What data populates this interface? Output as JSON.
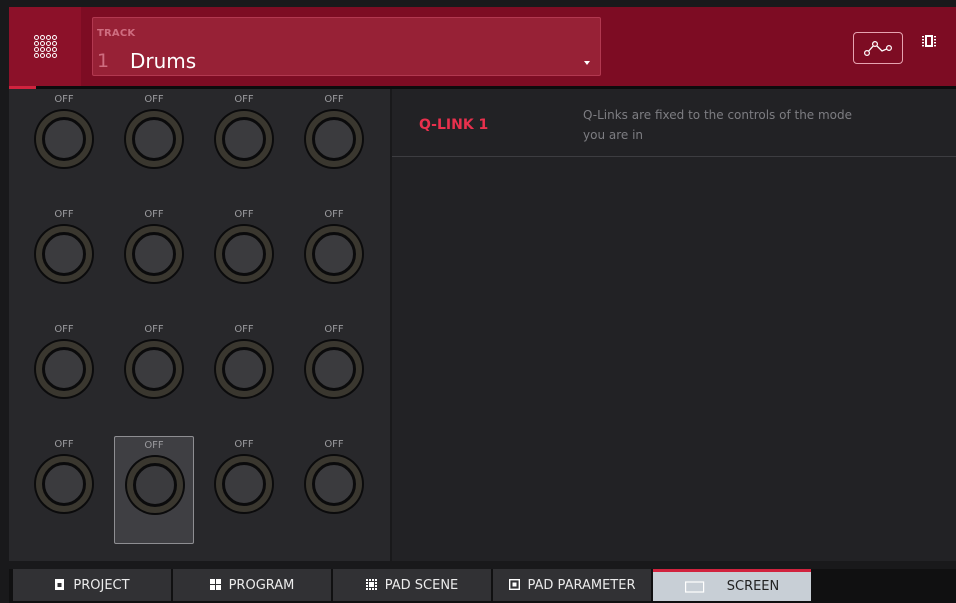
{
  "header": {
    "track_label": "TRACK",
    "track_number": "1",
    "track_name": "Drums"
  },
  "knobs": [
    {
      "value": "OFF"
    },
    {
      "value": "OFF"
    },
    {
      "value": "OFF"
    },
    {
      "value": "OFF"
    },
    {
      "value": "OFF"
    },
    {
      "value": "OFF"
    },
    {
      "value": "OFF"
    },
    {
      "value": "OFF"
    },
    {
      "value": "OFF"
    },
    {
      "value": "OFF"
    },
    {
      "value": "OFF"
    },
    {
      "value": "OFF"
    },
    {
      "value": "OFF"
    },
    {
      "value": "OFF"
    },
    {
      "value": "OFF"
    },
    {
      "value": "OFF"
    }
  ],
  "selected_knob": 13,
  "info": {
    "title": "Q-LINK 1",
    "description": "Q-Links are fixed to the controls of the mode you are in"
  },
  "tabs": [
    {
      "label": "PROJECT",
      "icon": "project-icon"
    },
    {
      "label": "PROGRAM",
      "icon": "program-icon"
    },
    {
      "label": "PAD SCENE",
      "icon": "pad-scene-icon"
    },
    {
      "label": "PAD PARAMETER",
      "icon": "pad-parameter-icon"
    },
    {
      "label": "SCREEN",
      "icon": "screen-icon"
    }
  ],
  "active_tab": "SCREEN",
  "colors": {
    "header": "#7d0c23",
    "accent": "#e8304d",
    "active_tab": "#c8cfd6"
  }
}
